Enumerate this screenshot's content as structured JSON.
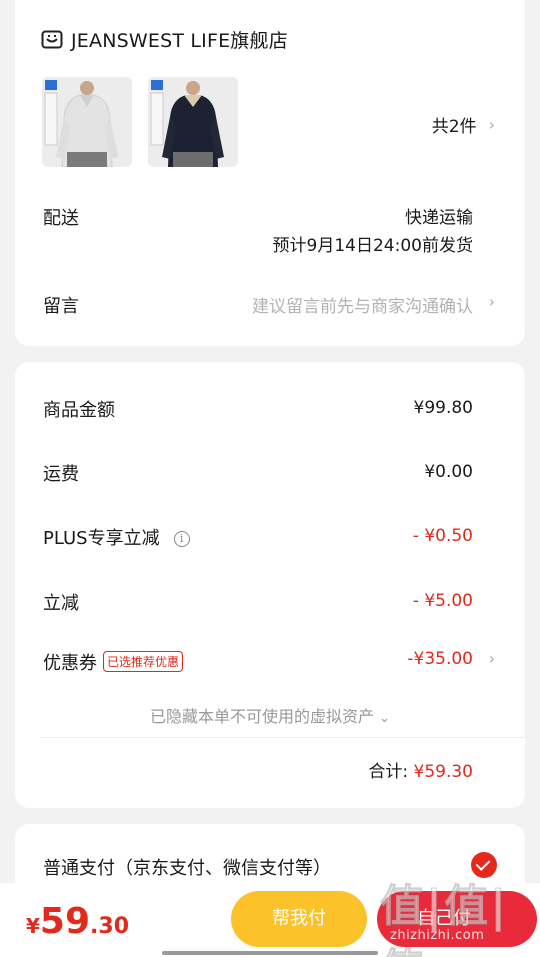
{
  "store": {
    "name": "JEANSWEST LIFE旗舰店",
    "icon": "store-icon"
  },
  "products": [
    {
      "name": "light-gray-polo-sweatshirt",
      "color": "#e6e6e6"
    },
    {
      "name": "navy-polo-sweatshirt",
      "color": "#1d2233"
    }
  ],
  "quantity_label": "共2件",
  "shipping": {
    "label": "配送",
    "method": "快递运输",
    "eta": "预计9月14日24:00前发货"
  },
  "note": {
    "label": "留言",
    "placeholder": "建议留言前先与商家沟通确认"
  },
  "price": {
    "goods_label": "商品金额",
    "goods_value": "¥99.80",
    "freight_label": "运费",
    "freight_value": "¥0.00",
    "plus_label": "PLUS专享立减",
    "plus_value": "- ¥0.50",
    "discount_label": "立减",
    "discount_value": "- ¥5.00",
    "coupon_label": "优惠券",
    "coupon_tag": "已选推荐优惠",
    "coupon_value": "-¥35.00",
    "hidden_note": "已隐藏本单不可使用的虚拟资产",
    "total_label": "合计:",
    "total_value": "¥59.30"
  },
  "payment": {
    "label": "普通支付（京东支付、微信支付等）"
  },
  "bottom": {
    "currency": "¥",
    "amount_int": "59",
    "amount_dec": ".30",
    "help_pay": "帮我付",
    "self_pay": "自己付"
  },
  "watermark": {
    "big": "值|值|值",
    "small": "zhizhizhi.com"
  },
  "colors": {
    "accent_red": "#e2291b",
    "help_button": "#fcc22a",
    "pay_button": "#e82a3a"
  }
}
